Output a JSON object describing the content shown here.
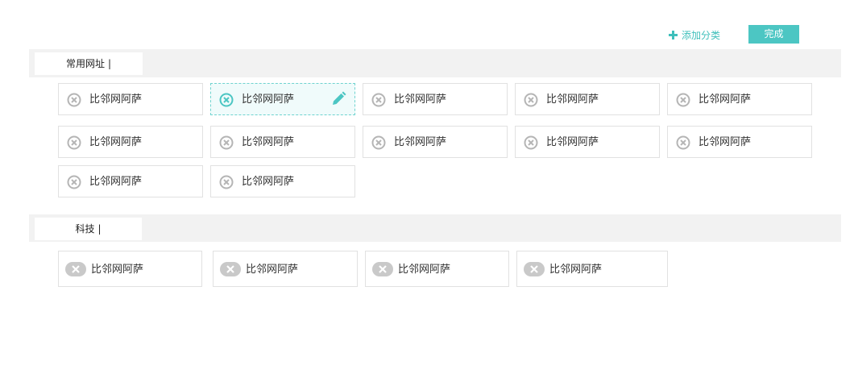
{
  "toolbar": {
    "add_category_label": "添加分类",
    "done_label": "完成"
  },
  "sections": [
    {
      "name": "常用网址",
      "caret": "|",
      "items": [
        {
          "label": "比邻网阿萨"
        },
        {
          "label": "比邻网阿萨",
          "active": true
        },
        {
          "label": "比邻网阿萨"
        },
        {
          "label": "比邻网阿萨"
        },
        {
          "label": "比邻网阿萨"
        },
        {
          "label": "比邻网阿萨"
        },
        {
          "label": "比邻网阿萨"
        },
        {
          "label": "比邻网阿萨"
        },
        {
          "label": "比邻网阿萨"
        },
        {
          "label": "比邻网阿萨"
        },
        {
          "label": "比邻网阿萨"
        },
        {
          "label": "比邻网阿萨"
        }
      ]
    },
    {
      "name": "科技",
      "caret": "|",
      "items": [
        {
          "label": "比邻网阿萨"
        },
        {
          "label": "比邻网阿萨"
        },
        {
          "label": "比邻网阿萨"
        },
        {
          "label": "比邻网阿萨"
        }
      ]
    }
  ],
  "colors": {
    "accent": "#4cc6c3",
    "active_border": "#6fd3cf",
    "delete_icon_grey": "#b5b5b5",
    "delete_icon_active": "#4cc6c3",
    "section_bg": "#f2f2f2"
  },
  "icons": {
    "add": "plus-icon",
    "delete": "close-circle-icon",
    "edit": "pencil-icon"
  }
}
